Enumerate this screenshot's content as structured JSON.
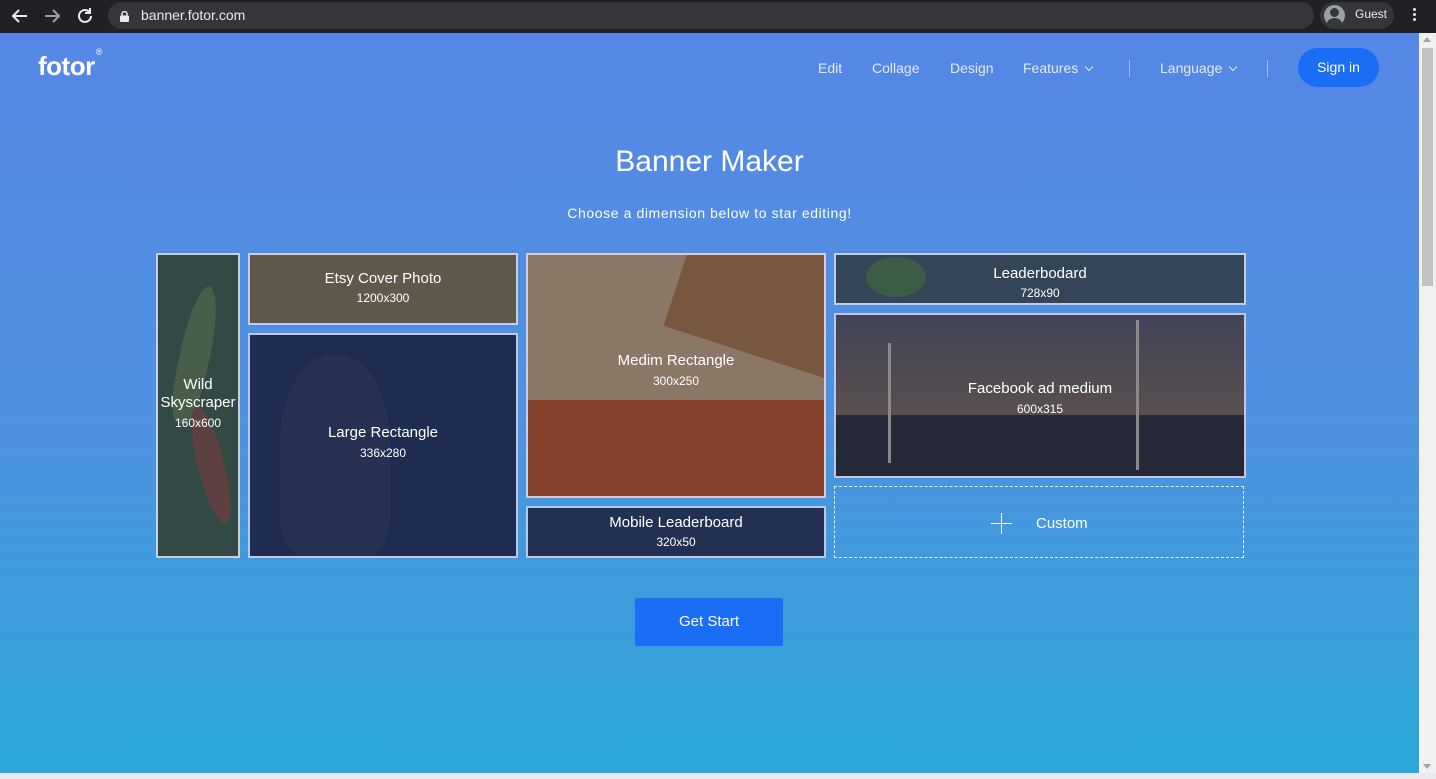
{
  "browser": {
    "url": "banner.fotor.com",
    "profile_label": "Guest"
  },
  "header": {
    "logo": "fotor",
    "logo_mark": "®",
    "nav": {
      "edit": "Edit",
      "collage": "Collage",
      "design": "Design",
      "features": "Features",
      "language": "Language"
    },
    "signin_label": "Sign in"
  },
  "main": {
    "title": "Banner Maker",
    "subtitle": "Choose a dimension below to star editing!",
    "tiles": {
      "wild_skyscraper": {
        "name": "Wild Skyscraper",
        "size": "160x600"
      },
      "etsy_cover": {
        "name": "Etsy Cover Photo",
        "size": "1200x300"
      },
      "large_rectangle": {
        "name": "Large Rectangle",
        "size": "336x280"
      },
      "medim_rectangle": {
        "name": "Medim Rectangle",
        "size": "300x250"
      },
      "mobile_leaderboard": {
        "name": "Mobile Leaderboard",
        "size": "320x50"
      },
      "leaderboard": {
        "name": "Leaderbodard",
        "size": "728x90"
      },
      "facebook_ad": {
        "name": "Facebook ad medium",
        "size": "600x315"
      },
      "custom": {
        "name": "Custom"
      }
    },
    "get_start_label": "Get Start"
  },
  "colors": {
    "accent": "#1a6ef5",
    "page_gradient_top": "#5687e6",
    "page_gradient_bottom": "#2aa7d8"
  },
  "icons": [
    "back-arrow-icon",
    "forward-arrow-icon",
    "reload-icon",
    "lock-icon",
    "profile-icon",
    "more-vert-icon",
    "chevron-down-icon",
    "plus-icon"
  ]
}
